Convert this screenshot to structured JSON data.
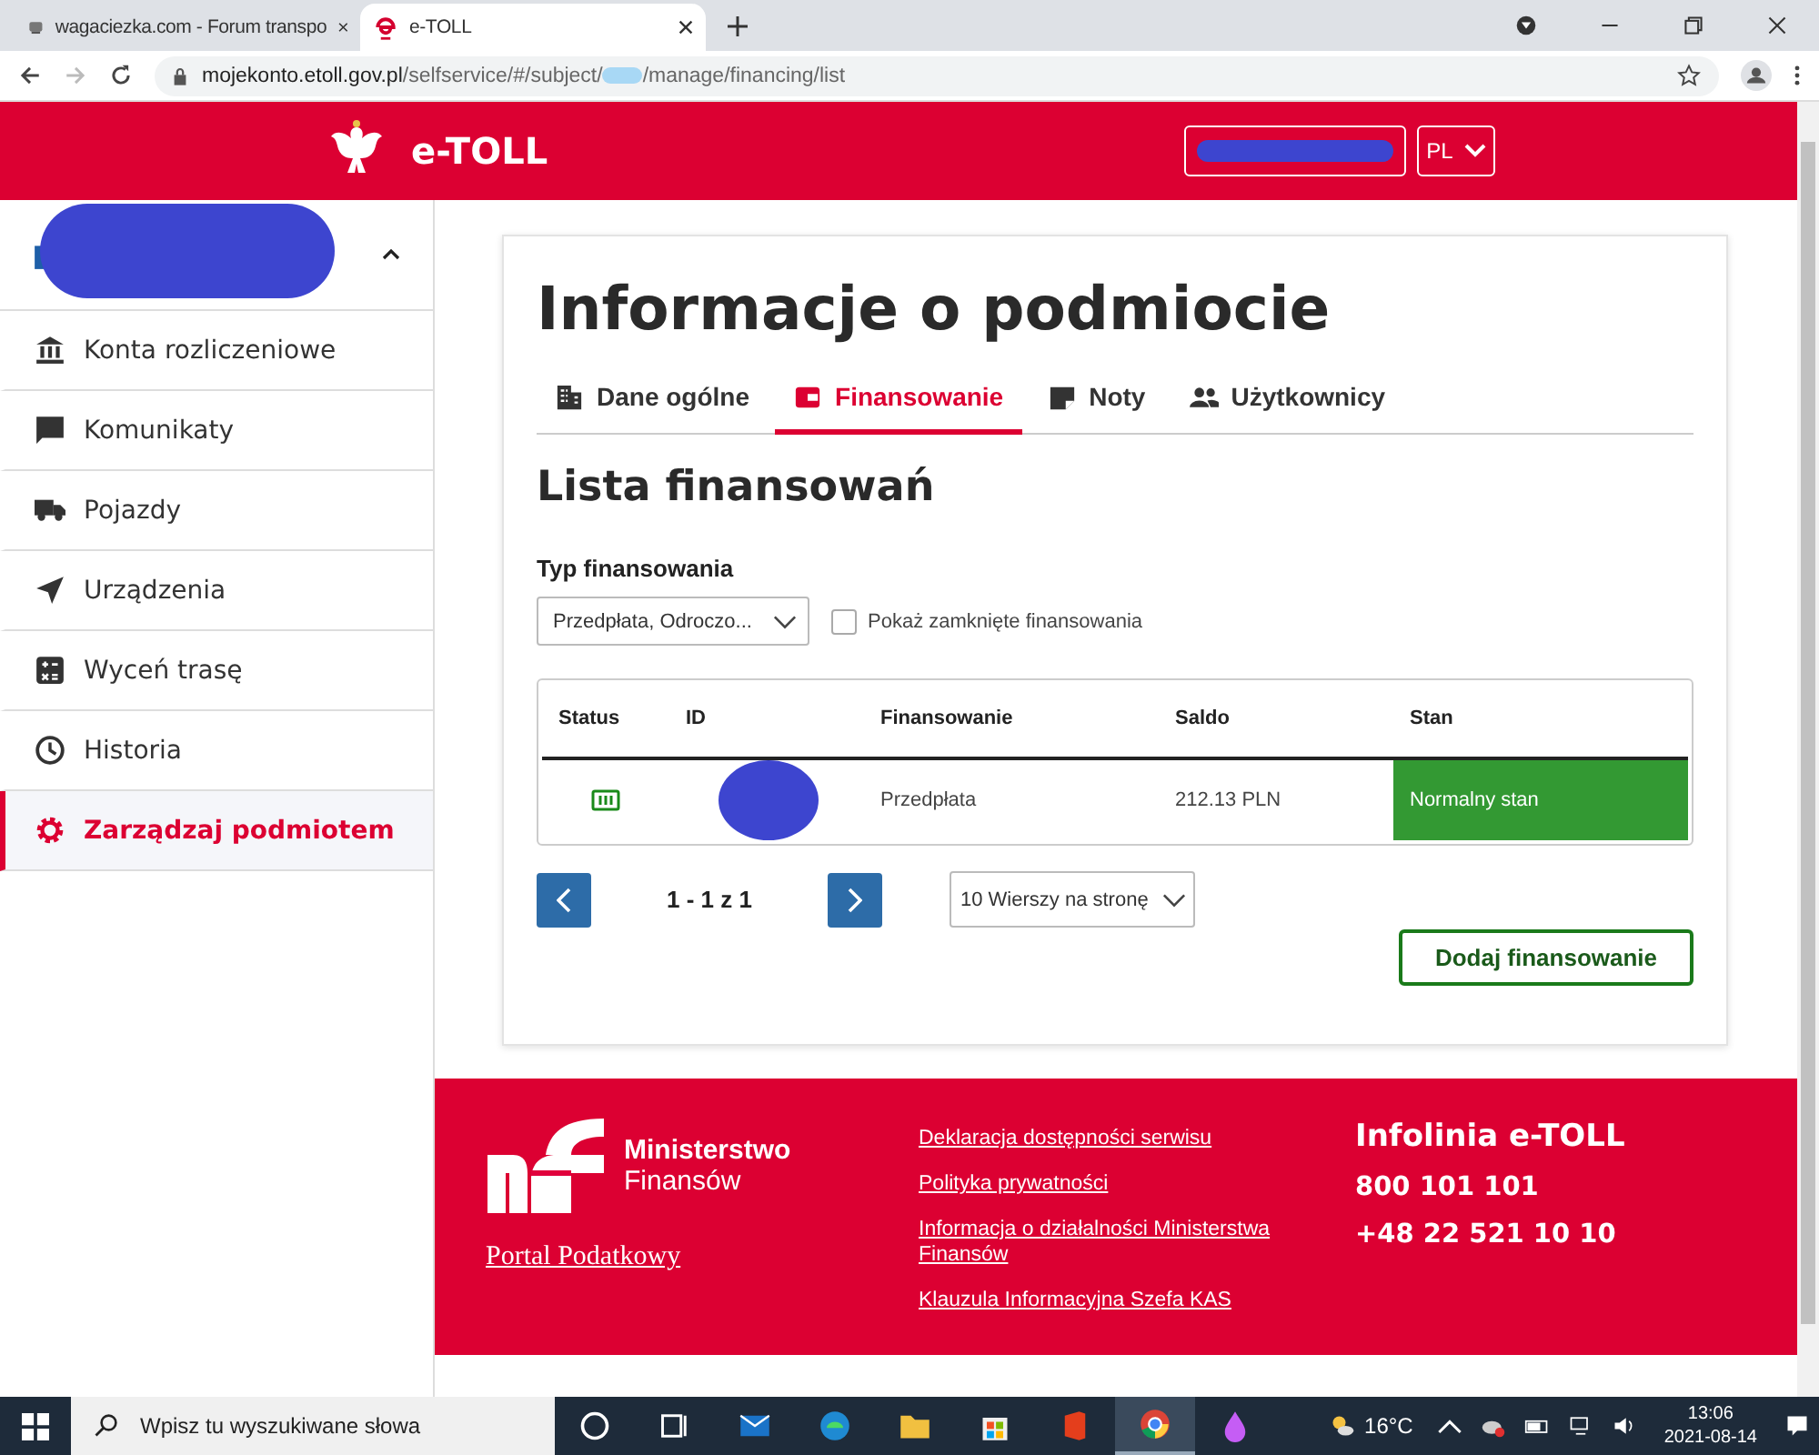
{
  "browser": {
    "tabs": [
      {
        "title": "wagaciezka.com - Forum transpo",
        "selected": false
      },
      {
        "title": "e-TOLL",
        "selected": true
      }
    ],
    "url_host": "mojekonto.etoll.gov.pl",
    "url_path": "/selfservice/#/subject/",
    "url_tail": "/manage/financing/list"
  },
  "header": {
    "logo": "e-TOLL",
    "language": "PL"
  },
  "sidebar": {
    "items": [
      {
        "label": "Konta rozliczeniowe",
        "selected": false
      },
      {
        "label": "Komunikaty",
        "selected": false
      },
      {
        "label": "Pojazdy",
        "selected": false
      },
      {
        "label": "Urządzenia",
        "selected": false
      },
      {
        "label": "Wyceń trasę",
        "selected": false
      },
      {
        "label": "Historia",
        "selected": false
      },
      {
        "label": "Zarządzaj podmiotem",
        "selected": true
      }
    ]
  },
  "main": {
    "title": "Informacje o podmiocie",
    "tabs": [
      {
        "label": "Dane ogólne",
        "selected": false
      },
      {
        "label": "Finansowanie",
        "selected": true
      },
      {
        "label": "Noty",
        "selected": false
      },
      {
        "label": "Użytkownicy",
        "selected": false
      }
    ],
    "subtitle": "Lista finansowań",
    "filter_label": "Typ finansowania",
    "filter_value": "Przedpłata, Odroczo...",
    "closed_checkbox": {
      "label": "Pokaż zamknięte finansowania",
      "checked": false
    },
    "table": {
      "columns": [
        "Status",
        "ID",
        "Finansowanie",
        "Saldo",
        "Stan"
      ],
      "rows": [
        {
          "financing": "Przedpłata",
          "balance": "212.13 PLN",
          "state": "Normalny stan",
          "color": "#339933"
        }
      ]
    },
    "pagination": {
      "range": "1 - 1 z 1",
      "page_size": "10 Wierszy na stronę"
    },
    "add_button": "Dodaj finansowanie"
  },
  "footer": {
    "ministry_line1": "Ministerstwo",
    "ministry_line2": "Finansów",
    "portal": "Portal Podatkowy",
    "links": [
      "Deklaracja dostępności serwisu",
      "Polityka prywatności",
      "Informacja o działalności Ministerstwa Finansów",
      "Klauzula Informacyjna Szefa KAS"
    ],
    "hotline_title": "Infolinia e-TOLL",
    "phones": [
      "800 101 101",
      "+48 22 521 10 10"
    ]
  },
  "taskbar": {
    "search_placeholder": "Wpisz tu wyszukiwane słowa",
    "temperature": "16°C",
    "time": "13:06",
    "date": "2021-08-14"
  }
}
